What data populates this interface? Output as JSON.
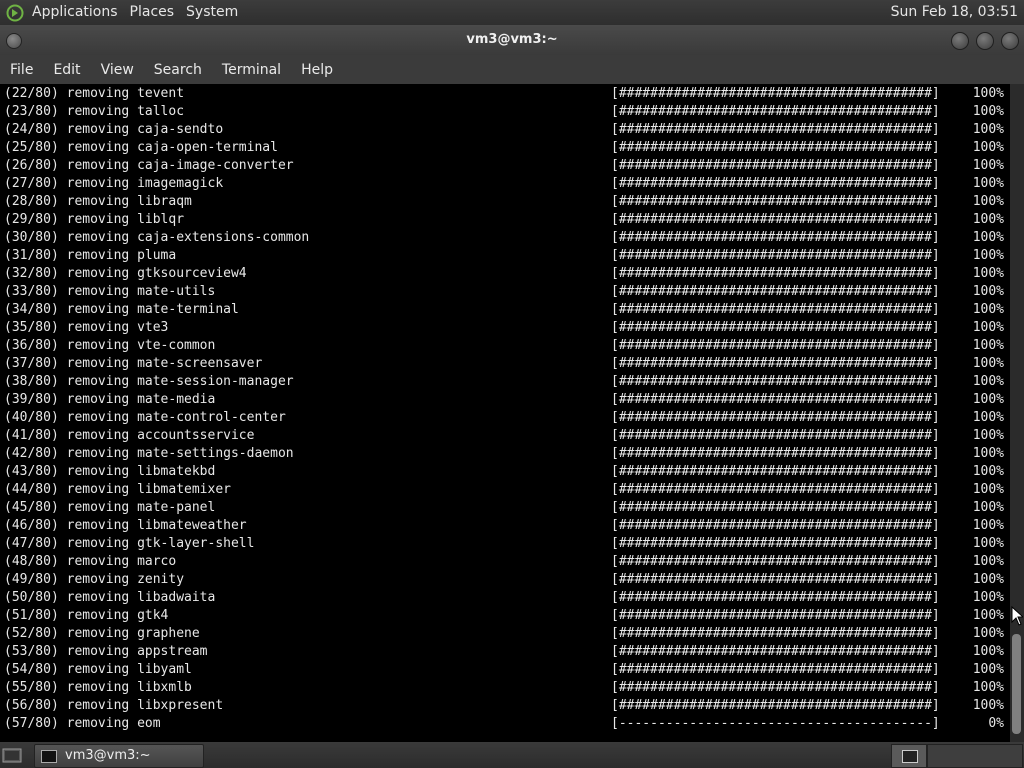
{
  "top_panel": {
    "menus": [
      "Applications",
      "Places",
      "System"
    ],
    "clock": "Sun Feb 18, 03:51"
  },
  "window": {
    "title": "vm3@vm3:~",
    "menu": [
      "File",
      "Edit",
      "View",
      "Search",
      "Terminal",
      "Help"
    ]
  },
  "terminal": {
    "lines": [
      {
        "prefix": "(22/80) removing ",
        "pkg": "tevent",
        "bar": "[########################################]",
        "pct": "100%"
      },
      {
        "prefix": "(23/80) removing ",
        "pkg": "talloc",
        "bar": "[########################################]",
        "pct": "100%"
      },
      {
        "prefix": "(24/80) removing ",
        "pkg": "caja-sendto",
        "bar": "[########################################]",
        "pct": "100%"
      },
      {
        "prefix": "(25/80) removing ",
        "pkg": "caja-open-terminal",
        "bar": "[########################################]",
        "pct": "100%"
      },
      {
        "prefix": "(26/80) removing ",
        "pkg": "caja-image-converter",
        "bar": "[########################################]",
        "pct": "100%"
      },
      {
        "prefix": "(27/80) removing ",
        "pkg": "imagemagick",
        "bar": "[########################################]",
        "pct": "100%"
      },
      {
        "prefix": "(28/80) removing ",
        "pkg": "libraqm",
        "bar": "[########################################]",
        "pct": "100%"
      },
      {
        "prefix": "(29/80) removing ",
        "pkg": "liblqr",
        "bar": "[########################################]",
        "pct": "100%"
      },
      {
        "prefix": "(30/80) removing ",
        "pkg": "caja-extensions-common",
        "bar": "[########################################]",
        "pct": "100%"
      },
      {
        "prefix": "(31/80) removing ",
        "pkg": "pluma",
        "bar": "[########################################]",
        "pct": "100%"
      },
      {
        "prefix": "(32/80) removing ",
        "pkg": "gtksourceview4",
        "bar": "[########################################]",
        "pct": "100%"
      },
      {
        "prefix": "(33/80) removing ",
        "pkg": "mate-utils",
        "bar": "[########################################]",
        "pct": "100%"
      },
      {
        "prefix": "(34/80) removing ",
        "pkg": "mate-terminal",
        "bar": "[########################################]",
        "pct": "100%"
      },
      {
        "prefix": "(35/80) removing ",
        "pkg": "vte3",
        "bar": "[########################################]",
        "pct": "100%"
      },
      {
        "prefix": "(36/80) removing ",
        "pkg": "vte-common",
        "bar": "[########################################]",
        "pct": "100%"
      },
      {
        "prefix": "(37/80) removing ",
        "pkg": "mate-screensaver",
        "bar": "[########################################]",
        "pct": "100%"
      },
      {
        "prefix": "(38/80) removing ",
        "pkg": "mate-session-manager",
        "bar": "[########################################]",
        "pct": "100%"
      },
      {
        "prefix": "(39/80) removing ",
        "pkg": "mate-media",
        "bar": "[########################################]",
        "pct": "100%"
      },
      {
        "prefix": "(40/80) removing ",
        "pkg": "mate-control-center",
        "bar": "[########################################]",
        "pct": "100%"
      },
      {
        "prefix": "(41/80) removing ",
        "pkg": "accountsservice",
        "bar": "[########################################]",
        "pct": "100%"
      },
      {
        "prefix": "(42/80) removing ",
        "pkg": "mate-settings-daemon",
        "bar": "[########################################]",
        "pct": "100%"
      },
      {
        "prefix": "(43/80) removing ",
        "pkg": "libmatekbd",
        "bar": "[########################################]",
        "pct": "100%"
      },
      {
        "prefix": "(44/80) removing ",
        "pkg": "libmatemixer",
        "bar": "[########################################]",
        "pct": "100%"
      },
      {
        "prefix": "(45/80) removing ",
        "pkg": "mate-panel",
        "bar": "[########################################]",
        "pct": "100%"
      },
      {
        "prefix": "(46/80) removing ",
        "pkg": "libmateweather",
        "bar": "[########################################]",
        "pct": "100%"
      },
      {
        "prefix": "(47/80) removing ",
        "pkg": "gtk-layer-shell",
        "bar": "[########################################]",
        "pct": "100%"
      },
      {
        "prefix": "(48/80) removing ",
        "pkg": "marco",
        "bar": "[########################################]",
        "pct": "100%"
      },
      {
        "prefix": "(49/80) removing ",
        "pkg": "zenity",
        "bar": "[########################################]",
        "pct": "100%"
      },
      {
        "prefix": "(50/80) removing ",
        "pkg": "libadwaita",
        "bar": "[########################################]",
        "pct": "100%"
      },
      {
        "prefix": "(51/80) removing ",
        "pkg": "gtk4",
        "bar": "[########################################]",
        "pct": "100%"
      },
      {
        "prefix": "(52/80) removing ",
        "pkg": "graphene",
        "bar": "[########################################]",
        "pct": "100%"
      },
      {
        "prefix": "(53/80) removing ",
        "pkg": "appstream",
        "bar": "[########################################]",
        "pct": "100%"
      },
      {
        "prefix": "(54/80) removing ",
        "pkg": "libyaml",
        "bar": "[########################################]",
        "pct": "100%"
      },
      {
        "prefix": "(55/80) removing ",
        "pkg": "libxmlb",
        "bar": "[########################################]",
        "pct": "100%"
      },
      {
        "prefix": "(56/80) removing ",
        "pkg": "libxpresent",
        "bar": "[########################################]",
        "pct": "100%"
      },
      {
        "prefix": "(57/80) removing ",
        "pkg": "eom",
        "bar": "[----------------------------------------]",
        "pct": "0%"
      }
    ]
  },
  "taskbar": {
    "task_label": "vm3@vm3:~"
  },
  "colors": {
    "terminal_bg": "#000000",
    "terminal_fg": "#e8e8e8",
    "panel_bg": "#3a3a3a"
  }
}
